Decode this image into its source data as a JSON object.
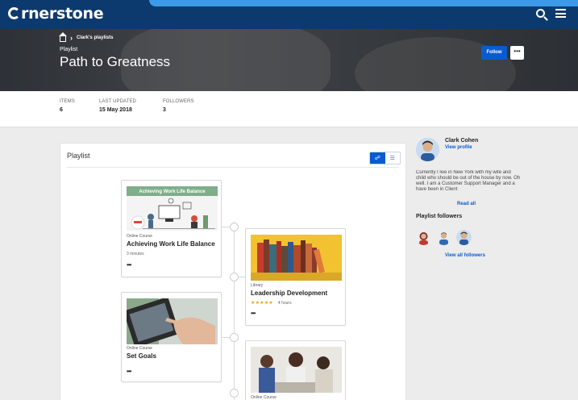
{
  "app": {
    "brand": "cornerstone",
    "brand_rest": "rnerstone",
    "search_icon": "search-icon",
    "menu_icon": "hamburger-icon"
  },
  "header": {
    "breadcrumb": "Clark's playlists",
    "kind": "Playlist",
    "title": "Path to Greatness",
    "follow_label": "Follow",
    "more_label": "•••"
  },
  "stats": [
    {
      "label": "ITEMS",
      "value": "6"
    },
    {
      "label": "LAST UPDATED",
      "value": "15 May 2018"
    },
    {
      "label": "FOLLOWERS",
      "value": "3"
    }
  ],
  "playlist": {
    "title": "Playlist",
    "items": [
      {
        "type": "Online Course",
        "title": "Achieving Work Life Balance",
        "meta": "3 minutes",
        "banner": "Achieving Work Life Balance",
        "more": "•••"
      },
      {
        "type": "Library",
        "title": "Leadership Development",
        "rating": 4.5,
        "stars": "★★★★★",
        "meta": "4 hours",
        "more": "•••"
      },
      {
        "type": "Online Course",
        "title": "Set Goals",
        "more": "•••"
      },
      {
        "type": "Online Course"
      }
    ]
  },
  "owner": {
    "name": "Clark Cohen",
    "view_profile": "View profile",
    "bio": "Currently I live in New York with my wife and child who should be out of the house by now. Oh well. I am a Customer Support Manager and a have been in Client",
    "read_all": "Read all"
  },
  "followers": {
    "heading": "Playlist followers",
    "view_all": "View all followers"
  },
  "colors": {
    "topbar": "#0c3a6e",
    "accent": "#3d9ae8",
    "primary": "#0a5bd0",
    "stars": "#e8a60c"
  }
}
